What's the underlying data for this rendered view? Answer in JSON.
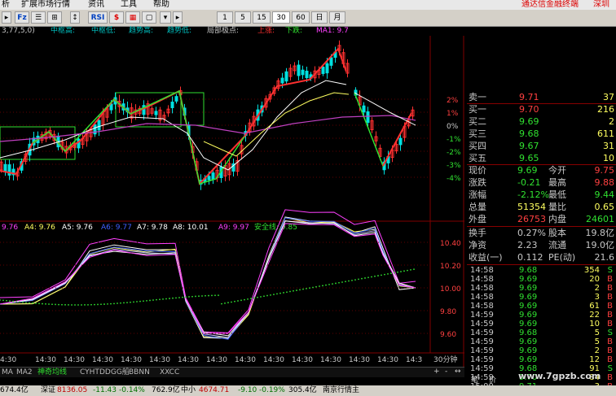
{
  "menu": {
    "items": [
      "析",
      "扩展市场行情",
      "资讯",
      "工具",
      "帮助"
    ],
    "brand": "通达信金融终端",
    "brand_tail": "深圳"
  },
  "toolbar": {
    "buttons": [
      "Fz",
      "☰",
      "⊞",
      "RSI",
      "$",
      "▦",
      "1",
      "5",
      "15",
      "30",
      "60",
      "日",
      "月"
    ]
  },
  "indicator_top": {
    "params": "3,77,5,0)",
    "items": [
      {
        "label": "中枢高:",
        "color": "#00c0c0"
      },
      {
        "label": "中枢低:",
        "color": "#00c0c0"
      },
      {
        "label": "趋势高:",
        "color": "#00c0c0"
      },
      {
        "label": "趋势低:",
        "color": "#00c0c0"
      },
      {
        "label": "局部极点:",
        "color": "#c8c8c8"
      },
      {
        "label": "上涨:",
        "color": "#ff3030"
      },
      {
        "label": "下跌:",
        "color": "#30e030"
      },
      {
        "label": "MA1: 9.7",
        "color": "#ff40ff"
      }
    ]
  },
  "indicator_bottom": {
    "items": [
      {
        "label": "9.76",
        "color": "#ff40ff"
      },
      {
        "label": "A4: 9.76",
        "color": "#ffff60"
      },
      {
        "label": "A5: 9.76",
        "color": "#ffffff"
      },
      {
        "label": "A6: 9.77",
        "color": "#4060ff"
      },
      {
        "label": "A7: 9.78",
        "color": "#ffffff"
      },
      {
        "label": "A8: 10.01",
        "color": "#ffffff"
      },
      {
        "label": "A9: 9.97",
        "color": "#ff40ff"
      },
      {
        "label": "安全线: 9.85",
        "color": "#30e030"
      }
    ]
  },
  "price_axis": [
    "2%",
    "1%",
    "0%",
    "-1%",
    "-2%",
    "-3%",
    "-4%"
  ],
  "osc_axis": [
    "10.40",
    "10.20",
    "10.00",
    "9.80",
    "9.60"
  ],
  "time_axis": [
    "4:30",
    "14:30",
    "14:30",
    "14:30",
    "14:30",
    "14:30",
    "14:30",
    "14:30",
    "14:30",
    "14:30",
    "14:30",
    "14:30",
    "14:30",
    "14:30",
    "14:3"
  ],
  "period_label": "30分钟",
  "quote": {
    "asks": [
      {
        "label": "卖一",
        "price": "9.71",
        "vol": "37"
      }
    ],
    "bids": [
      {
        "label": "买一",
        "price": "9.70",
        "vol": "216"
      },
      {
        "label": "买二",
        "price": "9.69",
        "vol": "2"
      },
      {
        "label": "买三",
        "price": "9.68",
        "vol": "611"
      },
      {
        "label": "买四",
        "price": "9.67",
        "vol": "31"
      },
      {
        "label": "买五",
        "price": "9.65",
        "vol": "10"
      }
    ],
    "stats": [
      {
        "l1": "现价",
        "v1": "9.69",
        "l2": "今开",
        "v2": "9.75",
        "c1": "#30e030",
        "c2": "#ff4040"
      },
      {
        "l1": "涨跌",
        "v1": "-0.21",
        "l2": "最高",
        "v2": "9.88",
        "c1": "#30e030",
        "c2": "#ff4040"
      },
      {
        "l1": "涨幅",
        "v1": "-2.12%",
        "l2": "最低",
        "v2": "9.44",
        "c1": "#30e030",
        "c2": "#30e030"
      },
      {
        "l1": "总量",
        "v1": "51354",
        "l2": "量比",
        "v2": "0.65",
        "c1": "#ffff60",
        "c2": "#ffff60"
      },
      {
        "l1": "外盘",
        "v1": "26753",
        "l2": "内盘",
        "v2": "24601",
        "c1": "#ff4040",
        "c2": "#30e030"
      }
    ],
    "stats2": [
      {
        "l1": "换手",
        "v1": "0.27%",
        "l2": "股本",
        "v2": "19.8亿"
      },
      {
        "l1": "净资",
        "v1": "2.23",
        "l2": "流通",
        "v2": "19.0亿"
      },
      {
        "l1": "收益(一)",
        "v1": "0.112",
        "l2": "PE(动)",
        "v2": "21.6"
      }
    ]
  },
  "ticks": [
    {
      "t": "14:58",
      "p": "9.68",
      "v": "354",
      "s": "S"
    },
    {
      "t": "14:58",
      "p": "9.69",
      "v": "20",
      "s": "B"
    },
    {
      "t": "14:58",
      "p": "9.69",
      "v": "2",
      "s": "B"
    },
    {
      "t": "14:58",
      "p": "9.69",
      "v": "3",
      "s": "B"
    },
    {
      "t": "14:58",
      "p": "9.69",
      "v": "61",
      "s": "B"
    },
    {
      "t": "14:59",
      "p": "9.69",
      "v": "22",
      "s": "B"
    },
    {
      "t": "14:59",
      "p": "9.69",
      "v": "10",
      "s": "B"
    },
    {
      "t": "14:59",
      "p": "9.68",
      "v": "5",
      "s": "S"
    },
    {
      "t": "14:59",
      "p": "9.69",
      "v": "5",
      "s": "B"
    },
    {
      "t": "14:59",
      "p": "9.69",
      "v": "2",
      "s": "B"
    },
    {
      "t": "14:59",
      "p": "9.69",
      "v": "12",
      "s": "B"
    },
    {
      "t": "14:59",
      "p": "9.68",
      "v": "91",
      "s": "S"
    },
    {
      "t": "14:59",
      "p": "9.70",
      "v": "84",
      "s": "B"
    },
    {
      "t": "15:00",
      "p": "9.71",
      "v": "3",
      "s": "B"
    }
  ],
  "tabs": [
    "MA",
    "MA2",
    "神奇均线",
    "CYHT",
    "DDGG船",
    "BBNN",
    "XXCC"
  ],
  "right_tabs": [
    "笔",
    "价"
  ],
  "status": {
    "items": [
      "674.4亿",
      "深证",
      "8136.05",
      "-11.43",
      "-0.14%",
      "762.9亿",
      "中小",
      "4674.71",
      "-9.10",
      "-0.19%",
      "305.4亿",
      "南京行情主"
    ]
  },
  "watermark": "www.7gpzb.com",
  "colors": {
    "up": "#ff3030",
    "down": "#30e030",
    "bg": "#000000",
    "grid": "#800000"
  }
}
